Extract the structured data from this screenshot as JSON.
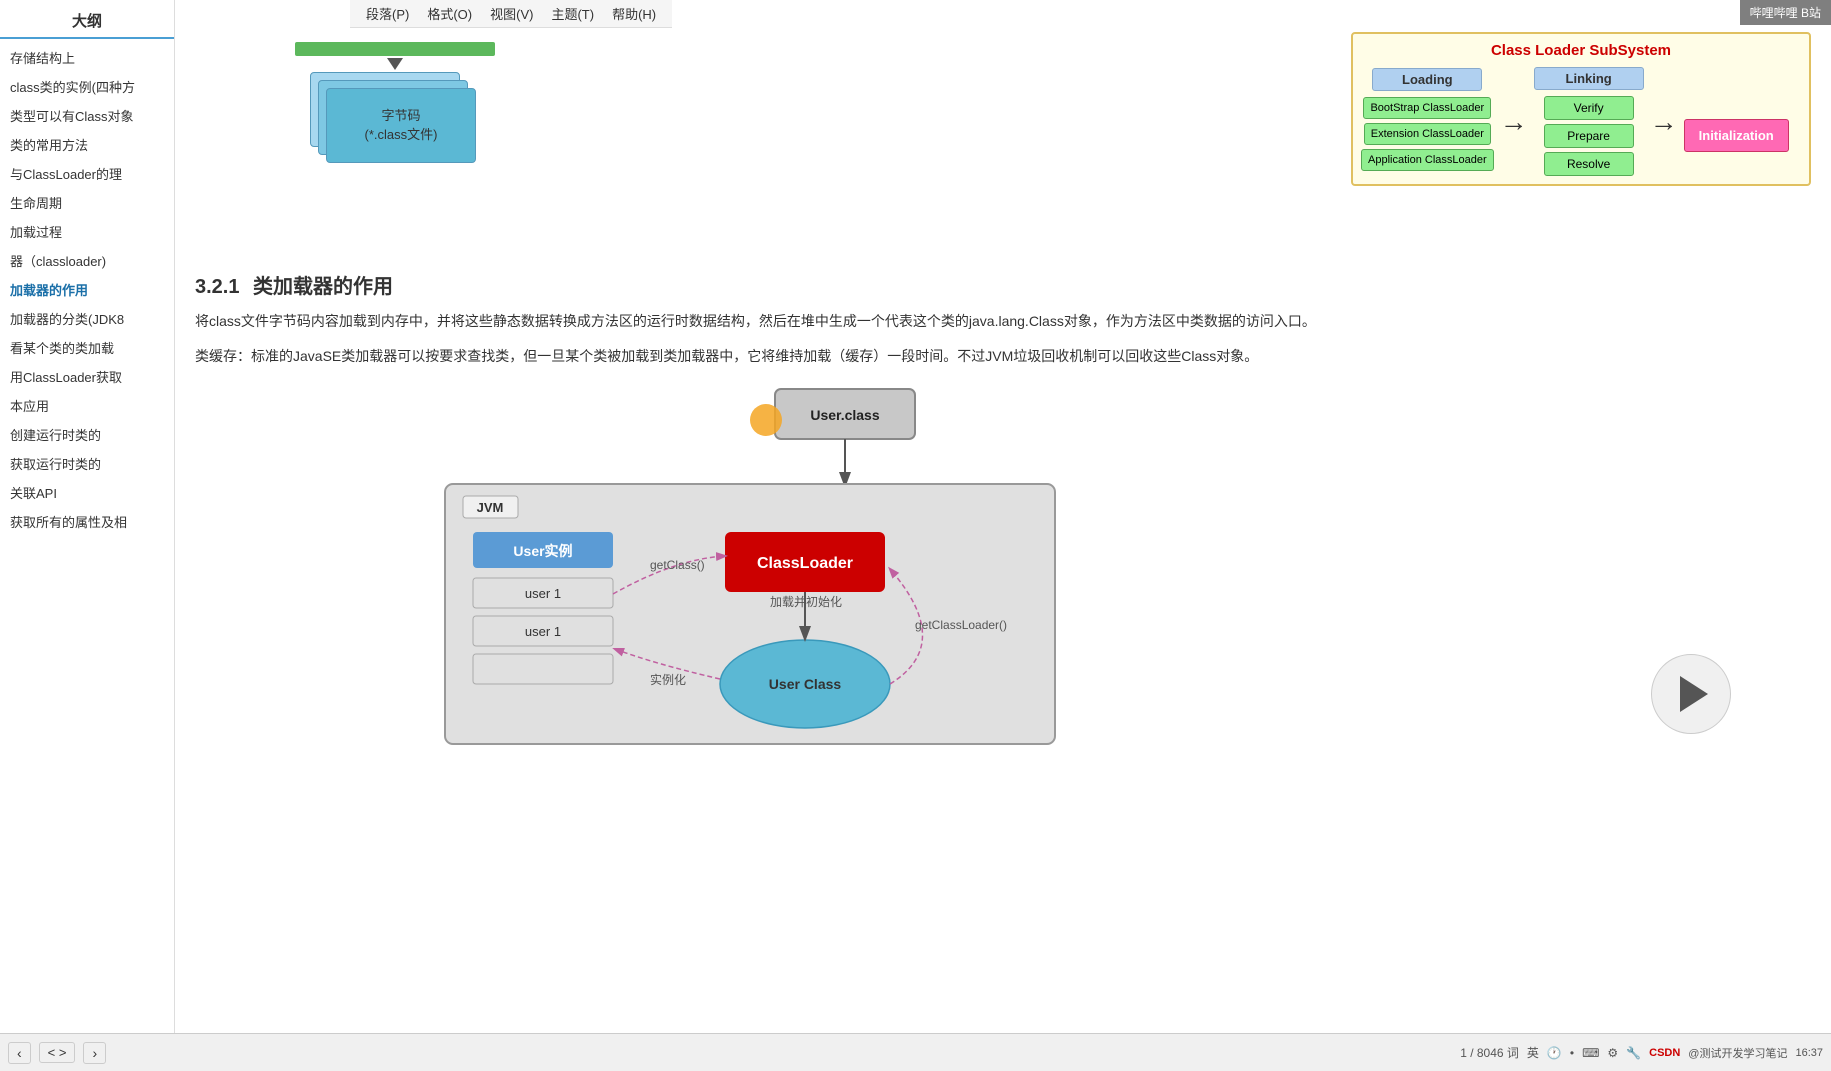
{
  "app": {
    "title": "CSDN 测试开发学习笔记",
    "watermark": "哔哩哔哩 B站"
  },
  "menu": {
    "items": [
      "段落(P)",
      "格式(O)",
      "视图(V)",
      "主题(T)",
      "帮助(H)"
    ]
  },
  "sidebar": {
    "title": "大纲",
    "items": [
      {
        "label": "存储结构上"
      },
      {
        "label": "class类的实例(四种方"
      },
      {
        "label": "类型可以有Class对象"
      },
      {
        "label": "类的常用方法"
      },
      {
        "label": "与ClassLoader的理"
      },
      {
        "label": "生命周期"
      },
      {
        "label": "加载过程"
      },
      {
        "label": "器（classloader)"
      },
      {
        "label": "加载器的作用",
        "active": true
      },
      {
        "label": "加载器的分类(JDK8"
      },
      {
        "label": "看某个类的类加载"
      },
      {
        "label": "用ClassLoader获取"
      },
      {
        "label": "本应用"
      },
      {
        "label": "创建运行时类的"
      },
      {
        "label": "获取运行时类的"
      },
      {
        "label": "关联API"
      },
      {
        "label": "获取所有的属性及相"
      }
    ]
  },
  "classloader_subsystem": {
    "title": "Class Loader SubSystem",
    "loading": {
      "title": "Loading",
      "items": [
        "BootStrap ClassLoader",
        "Extension ClassLoader",
        "Application ClassLoader"
      ]
    },
    "linking": {
      "title": "Linking",
      "items": [
        "Verify",
        "Prepare",
        "Resolve"
      ]
    },
    "initialization": {
      "title": "Initialization",
      "label": "Initialization"
    }
  },
  "section": {
    "number": "3.2.1",
    "title": "类加载器的作用"
  },
  "paragraphs": {
    "p1": "将class文件字节码内容加载到内存中，并将这些静态数据转换成方法区的运行时数据结构，然后在堆中生成一个代表这个类的java.lang.Class对象，作为方法区中类数据的访问入口。",
    "p2": "类缓存：标准的JavaSE类加载器可以按要求查找类，但一旦某个类被加载到类加载器中，它将维持加载（缓存）一段时间。不过JVM垃圾回收机制可以回收这些Class对象。"
  },
  "jvm_diagram": {
    "user_class_file": "User.class",
    "jvm_label": "JVM",
    "user_instances_header": "User实例",
    "user_instances": [
      "user 1",
      "user 1"
    ],
    "classloader_label": "ClassLoader",
    "user_class_label": "User Class",
    "get_class_label": "getClass()",
    "load_init_label": "加载并初始化",
    "get_classloader_label": "getClassLoader()",
    "instantiate_label": "实例化"
  },
  "bytecode": {
    "title": "字节码\n(*.class文件)"
  },
  "bottom_bar": {
    "nav_prev": "‹",
    "nav_next": "›",
    "code_toggle": "< >",
    "word_count": "1 / 8046 词",
    "lang": "英",
    "page_info": "1 / 8046 词"
  }
}
